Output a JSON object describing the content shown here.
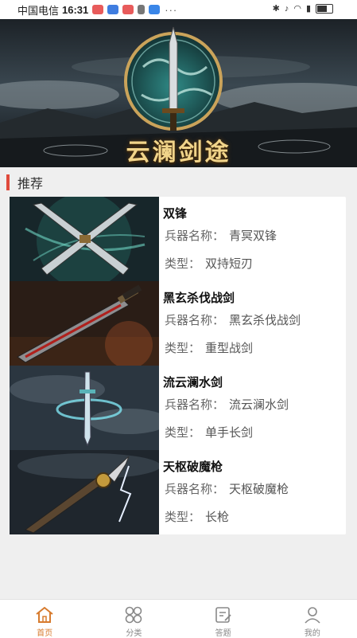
{
  "status_bar": {
    "carrier": "中国电信",
    "time": "16:31",
    "dots": "···"
  },
  "banner": {
    "title": "云澜剑途"
  },
  "section": {
    "title": "推荐"
  },
  "weapons": [
    {
      "name": "双锋",
      "name_label": "兵器名称：",
      "name_value": "青冥双锋",
      "type_label": "类型：",
      "type_value": "双持短刃"
    },
    {
      "name": "黑玄杀伐战剑",
      "name_label": "兵器名称：",
      "name_value": "黑玄杀伐战剑",
      "type_label": "类型：",
      "type_value": "重型战剑"
    },
    {
      "name": "流云澜水剑",
      "name_label": "兵器名称：",
      "name_value": "流云澜水剑",
      "type_label": "类型：",
      "type_value": "单手长剑"
    },
    {
      "name": "天枢破魔枪",
      "name_label": "兵器名称：",
      "name_value": "天枢破魔枪",
      "type_label": "类型：",
      "type_value": "长枪"
    }
  ],
  "tabs": [
    {
      "label": "首页",
      "icon": "home-icon",
      "active": true
    },
    {
      "label": "分类",
      "icon": "category-icon",
      "active": false
    },
    {
      "label": "答题",
      "icon": "quiz-icon",
      "active": false
    },
    {
      "label": "我的",
      "icon": "user-icon",
      "active": false
    }
  ],
  "colors": {
    "accent_bar": "#e04a3c",
    "active_tab": "#d77b2e",
    "banner_gold": "#f1d48a"
  }
}
